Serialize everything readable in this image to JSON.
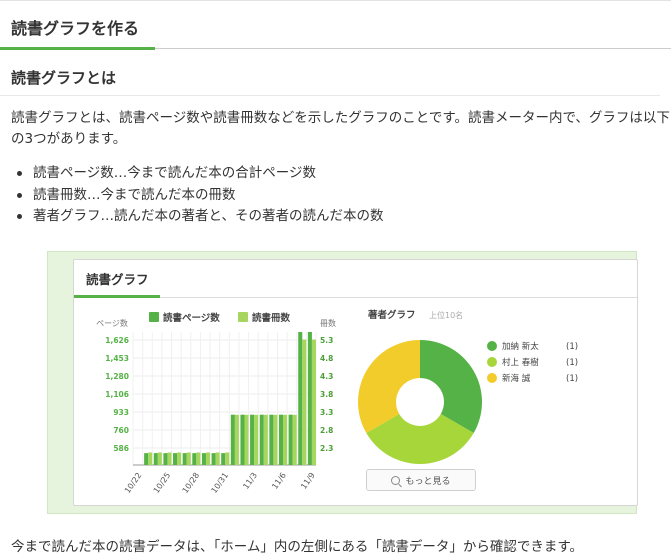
{
  "article": {
    "heading": "読書グラフを作る",
    "subheading": "読書グラフとは",
    "intro": "読書グラフとは、読書ページ数や読書冊数などを示したグラフのことです。読書メーター内で、グラフは以下の3つがあります。",
    "bullets": [
      "読書ページ数…今まで読んだ本の合計ページ数",
      "読書冊数…今まで読んだ本の冊数",
      "著者グラフ…読んだ本の著者と、その著者の読んだ本の数"
    ],
    "footer": "今まで読んだ本の読書データは、「ホーム」内の左側にある「読書データ」から確認できます。"
  },
  "widget": {
    "title": "読書グラフ",
    "more_button": "もっと見る"
  },
  "chart_data": [
    {
      "type": "bar",
      "x": [
        "10/22",
        "10/23",
        "10/24",
        "10/25",
        "10/26",
        "10/27",
        "10/28",
        "10/29",
        "10/30",
        "10/31",
        "11/1",
        "11/2",
        "11/3",
        "11/4",
        "11/5",
        "11/6",
        "11/7",
        "11/8",
        "11/9"
      ],
      "xtick_labels": [
        "10/22",
        "10/25",
        "10/28",
        "10/31",
        "11/3",
        "11/6",
        "11/9"
      ],
      "series": [
        {
          "name": "読書ページ数",
          "axis": "left",
          "color": "#55b246",
          "values": [
            0,
            145,
            145,
            145,
            145,
            145,
            145,
            145,
            145,
            145,
            615,
            615,
            615,
            615,
            615,
            615,
            615,
            1626,
            1626
          ]
        },
        {
          "name": "読書冊数",
          "axis": "right",
          "color": "#a6d65e",
          "values": [
            0,
            0.5,
            0.5,
            0.5,
            0.5,
            0.5,
            0.5,
            0.5,
            0.5,
            0.5,
            2,
            2,
            2,
            2,
            2,
            2,
            2,
            5,
            5
          ]
        }
      ],
      "ylabel_left": "ページ数",
      "ylabel_right": "冊数",
      "yticks_left": [
        "1,626",
        "1,453",
        "1,280",
        "1,106",
        "933",
        "760",
        "586"
      ],
      "yticks_right": [
        "5.3",
        "4.8",
        "4.3",
        "3.8",
        "3.3",
        "2.8",
        "2.3"
      ],
      "ylim_left": [
        0,
        1626
      ],
      "ylim_right": [
        0,
        5.3
      ],
      "legend_placement": "top"
    },
    {
      "type": "pie",
      "title": "著者グラフ",
      "subtitle": "上位10名",
      "labels": [
        "加納 新太",
        "村上 春樹",
        "新海 誠"
      ],
      "counts": [
        "(1)",
        "(1)",
        "(1)"
      ],
      "values": [
        1,
        1,
        1
      ],
      "colors": [
        "#55b246",
        "#a6d63a",
        "#f2cc2a"
      ],
      "legend_placement": "right"
    }
  ]
}
